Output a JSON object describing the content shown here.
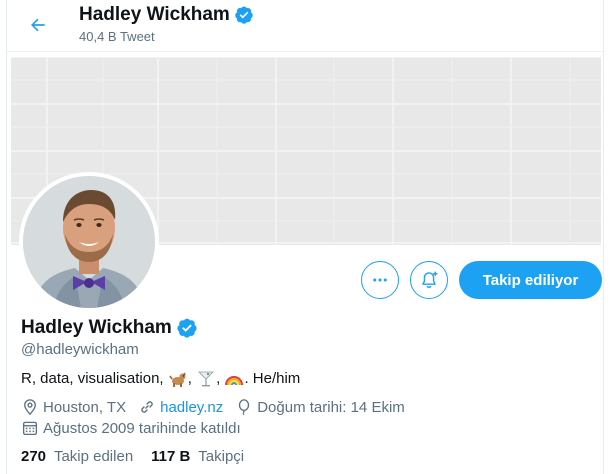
{
  "header": {
    "name": "Hadley Wickham",
    "tweet_count": "40,4 B Tweet"
  },
  "profile": {
    "name": "Hadley Wickham",
    "handle": "@hadleywickham",
    "bio_prefix": "R, data, visualisation,",
    "bio_sep1": ",",
    "bio_sep2": ",",
    "bio_suffix": ". He/him",
    "location": "Houston, TX",
    "website": "hadley.nz",
    "birthday": "Doğum tarihi: 14 Ekim",
    "joined": "Ağustos 2009 tarihinde katıldı"
  },
  "stats": {
    "following_count": "270",
    "following_label": "Takip edilen",
    "followers_count": "117 B",
    "followers_label": "Takipçi"
  },
  "buttons": {
    "follow_label": "Takip ediliyor"
  },
  "icons": {
    "back": "arrow-left-icon",
    "verified": "verified-badge-icon",
    "more": "more-horizontal-icon",
    "notify": "bell-plus-icon",
    "location": "location-pin-icon",
    "link": "link-icon",
    "birthday": "balloon-icon",
    "calendar": "calendar-icon",
    "bio_emoji": [
      "dog-emoji",
      "cocktail-emoji",
      "rainbow-emoji"
    ]
  },
  "colors": {
    "accent": "#1da1f2",
    "link": "#1b95e0",
    "muted": "#5b7083",
    "text": "#0f1419",
    "banner": "#e8e8e8"
  }
}
